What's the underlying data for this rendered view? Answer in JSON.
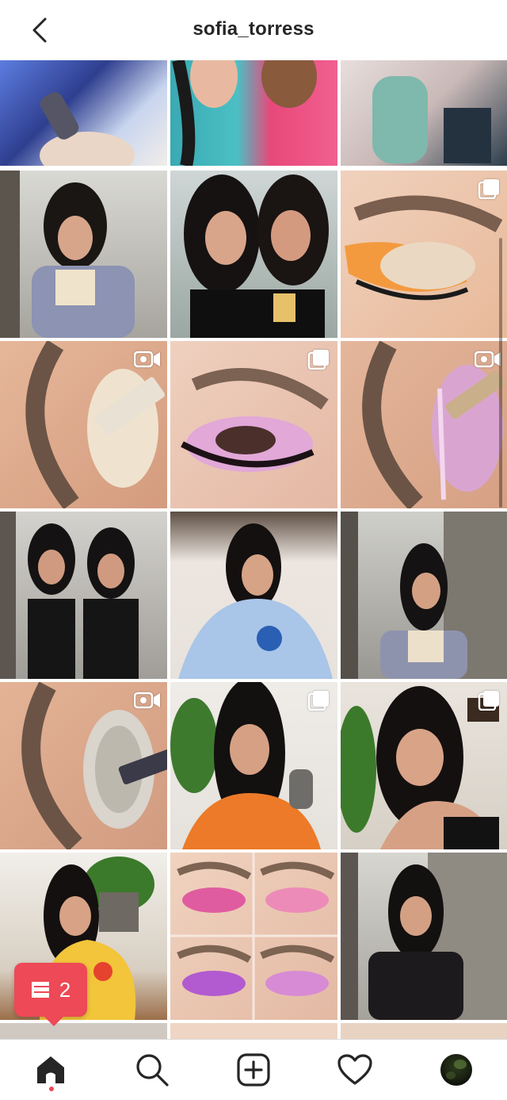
{
  "header": {
    "username": "sofia_torress"
  },
  "notification": {
    "count": "2"
  },
  "colors": {
    "accent": "#ed4956",
    "text": "#262626"
  },
  "icons": [
    "back-arrow-icon",
    "carousel-icon",
    "igtv-icon",
    "home-icon",
    "search-icon",
    "new-post-icon",
    "heart-icon",
    "profile-avatar",
    "notification-icon"
  ]
}
